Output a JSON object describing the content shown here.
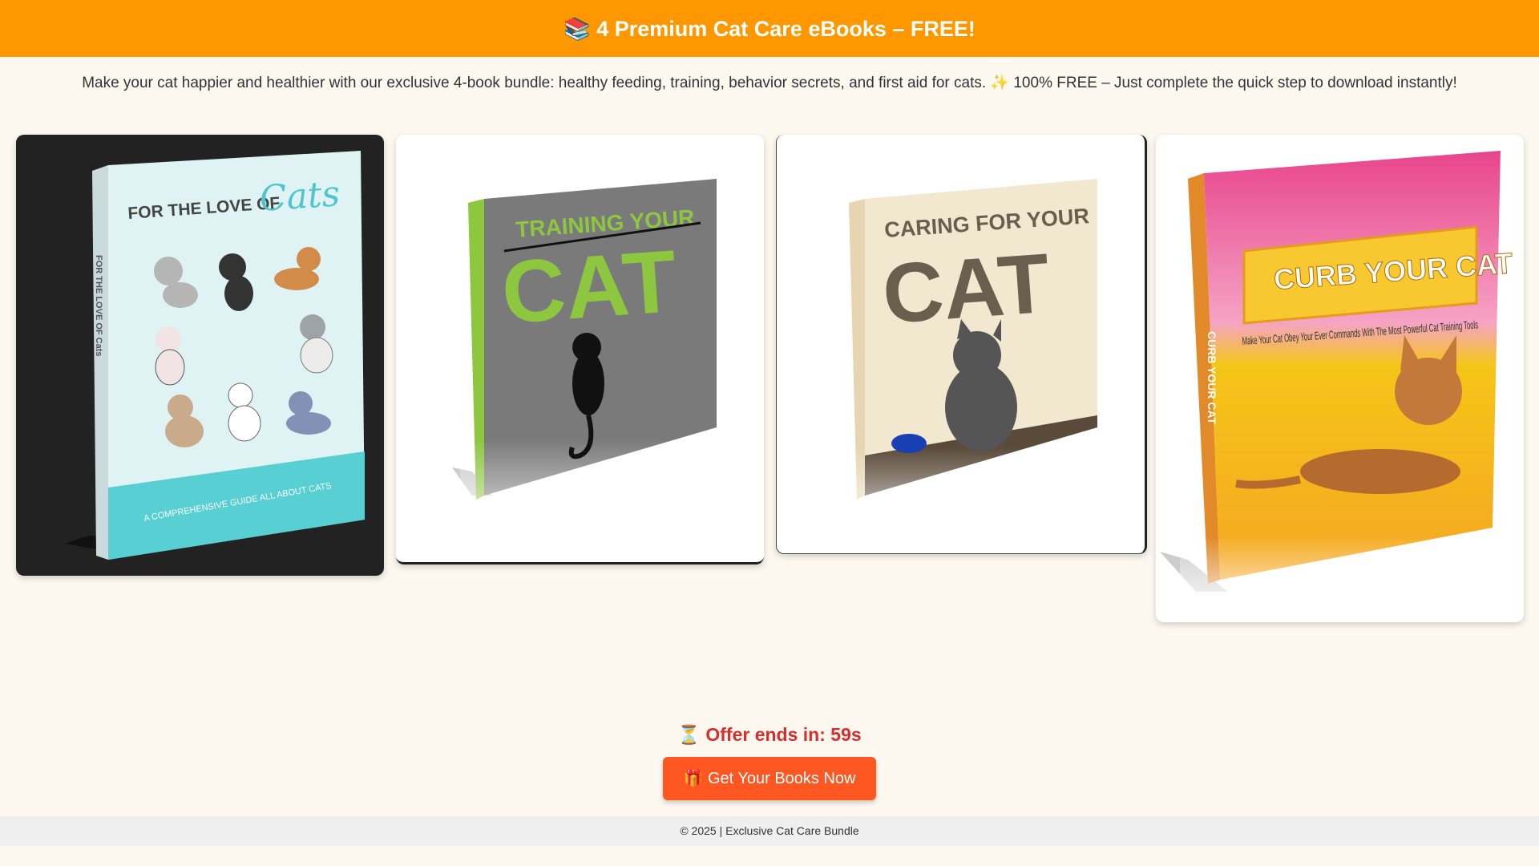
{
  "header": {
    "title": "📚 4 Premium Cat Care eBooks – FREE!"
  },
  "intro": {
    "text": "Make your cat happier and healthier with our exclusive 4-book bundle: healthy feeding, training, behavior secrets, and first aid for cats. ✨ 100% FREE – Just complete the quick step to download instantly!"
  },
  "books": [
    {
      "cover_title": "FOR THE LOVE OF",
      "cover_accent": "Cats",
      "cover_subtitle": "A COMPREHENSIVE GUIDE ALL ABOUT CATS",
      "spine": "FOR THE LOVE OF Cats",
      "colors": {
        "cover": "#dff3f4",
        "band": "#57cfd3",
        "accent": "#4fc6cc"
      }
    },
    {
      "cover_title": "TRAINING YOUR",
      "cover_accent": "CAT",
      "colors": {
        "cover": "#7a7a7a",
        "spine": "#8dc63f",
        "accent": "#8dc63f"
      }
    },
    {
      "cover_title": "CARING FOR YOUR",
      "cover_accent": "CAT",
      "colors": {
        "cover": "#f2e7cf",
        "accent": "#6a5e4f"
      }
    },
    {
      "cover_title": "CURB YOUR CAT",
      "cover_subtitle": "Make Your Cat Obey Your Ever Commands With The Most Powerful Cat Training Tools",
      "spine": "CURB YOUR CAT",
      "colors": {
        "top": "#e8458b",
        "bottom": "#f5a623"
      }
    }
  ],
  "timer": {
    "text": "⏳ Offer ends in: 59s"
  },
  "cta": {
    "label": "🎁 Get Your Books Now"
  },
  "footer": {
    "text": "© 2025 | Exclusive Cat Care Bundle"
  }
}
